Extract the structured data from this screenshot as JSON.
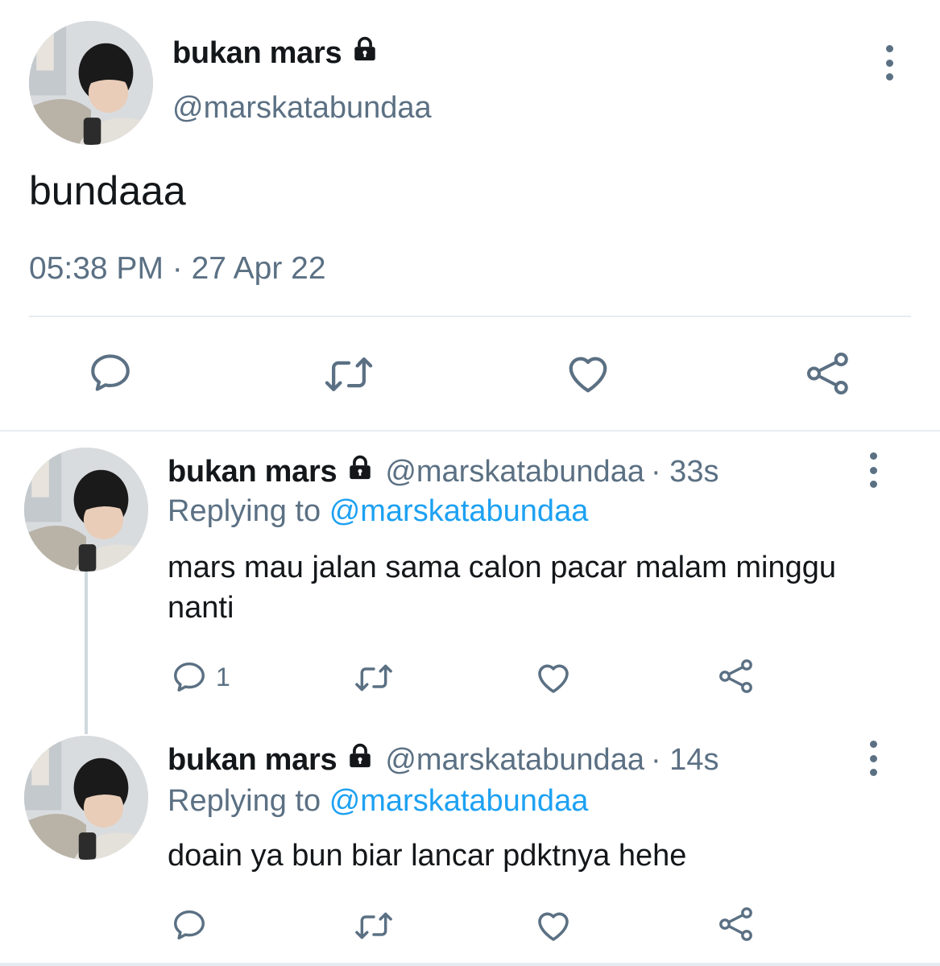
{
  "colors": {
    "text": "#14171a",
    "secondary": "#5b7083",
    "link": "#1da1f2",
    "divider": "#e6ecf0"
  },
  "icons": {
    "more": "more-vertical-icon",
    "lock": "lock-icon",
    "reply": "reply-icon",
    "retweet": "retweet-icon",
    "like": "heart-icon",
    "share": "share-icon"
  },
  "main_tweet": {
    "name": "bukan mars",
    "handle": "@marskatabundaa",
    "text": "bundaaa",
    "timestamp": "05:38 PM · 27 Apr 22"
  },
  "replies": [
    {
      "name": "bukan mars",
      "handle": "@marskatabundaa",
      "time": "· 33s",
      "replying_label": "Replying to",
      "replying_to": "@marskatabundaa",
      "text": "mars mau jalan sama calon pacar malam minggu nanti",
      "reply_count": "1"
    },
    {
      "name": "bukan mars",
      "handle": "@marskatabundaa",
      "time": "· 14s",
      "replying_label": "Replying to",
      "replying_to": "@marskatabundaa",
      "text": "doain ya bun biar lancar pdktnya hehe",
      "reply_count": ""
    }
  ]
}
